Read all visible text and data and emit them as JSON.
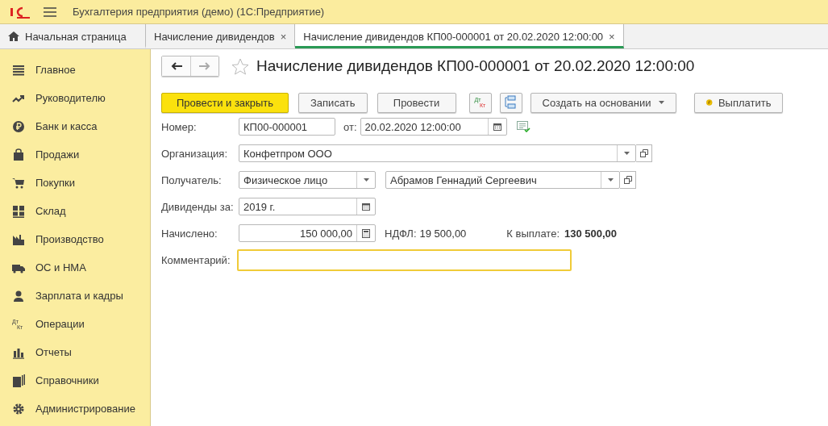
{
  "window": {
    "title": "Бухгалтерия предприятия (демо)  (1С:Предприятие)"
  },
  "tabs": [
    {
      "kind": "home",
      "label": "Начальная страница",
      "selected": false
    },
    {
      "kind": "doc",
      "label": "Начисление дивидендов",
      "selected": false,
      "close": "×"
    },
    {
      "kind": "doc",
      "label": "Начисление дивидендов КП00-000001 от 20.02.2020 12:00:00",
      "selected": true,
      "close": "×"
    }
  ],
  "sidebar": {
    "items": [
      {
        "label": "Главное"
      },
      {
        "label": "Руководителю"
      },
      {
        "label": "Банк и касса"
      },
      {
        "label": "Продажи"
      },
      {
        "label": "Покупки"
      },
      {
        "label": "Склад"
      },
      {
        "label": "Производство"
      },
      {
        "label": "ОС и НМА"
      },
      {
        "label": "Зарплата и кадры"
      },
      {
        "label": "Операции",
        "icon_text": [
          "Дт",
          "Кт"
        ]
      },
      {
        "label": "Отчеты"
      },
      {
        "label": "Справочники"
      },
      {
        "label": "Администрирование"
      }
    ]
  },
  "document": {
    "title": "Начисление дивидендов КП00-000001 от 20.02.2020 12:00:00",
    "toolbar": [
      {
        "kind": "primary",
        "label": "Провести и закрыть"
      },
      {
        "kind": "plain",
        "label": "Записать"
      },
      {
        "kind": "plain",
        "label": "Провести"
      },
      {
        "kind": "dtkt",
        "text": [
          "Дт",
          "Кт"
        ]
      },
      {
        "kind": "structure"
      },
      {
        "kind": "dropdown",
        "label": "Создать на основании"
      },
      {
        "kind": "pay",
        "label": "Выплатить"
      }
    ],
    "number": {
      "label": "Номер:",
      "value": "КП00-000001",
      "date_label": "от:",
      "date": "20.02.2020 12:00:00"
    },
    "organization": {
      "label": "Организация:",
      "value": "Конфетпром ООО"
    },
    "recipient": {
      "label": "Получатель:",
      "type": "Физическое лицо",
      "value": "Абрамов Геннадий Сергеевич"
    },
    "period": {
      "label": "Дивиденды за:",
      "value": "2019 г."
    },
    "accrued": {
      "label": "Начислено:",
      "value": "150 000,00",
      "tax_label": "НДФЛ:",
      "tax": "19 500,00",
      "payout_label": "К выплате:",
      "payout": "130 500,00"
    },
    "comment": {
      "label": "Комментарий:",
      "focused": true
    }
  }
}
